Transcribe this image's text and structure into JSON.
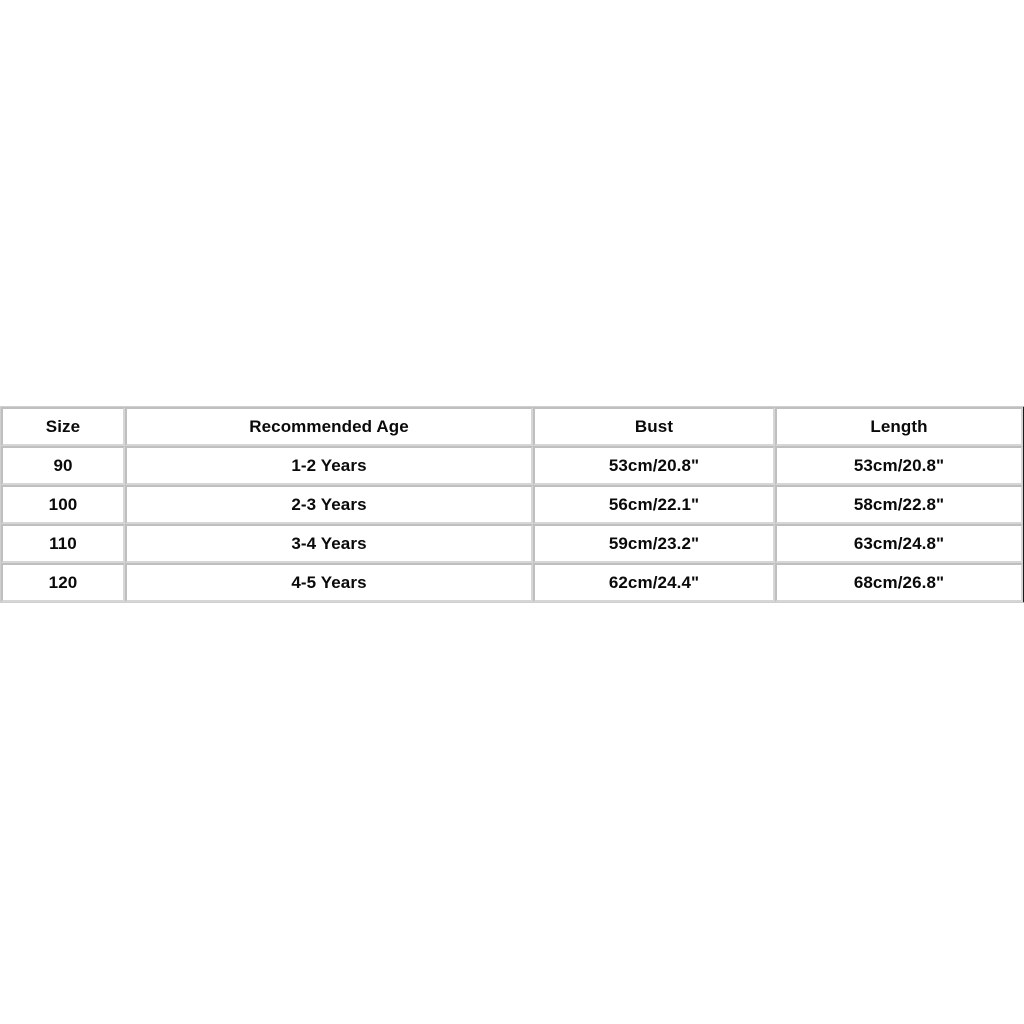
{
  "page": {
    "background_color": "#ffffff",
    "accent_color": "#1b1b1b"
  },
  "size_chart": {
    "name": "size-chart-table",
    "border_color": "#d6d6d6",
    "outer_border_color": "#1b1b1b",
    "text_color": "#0a0a0a",
    "columns": [
      {
        "key": "size",
        "label": "Size"
      },
      {
        "key": "age",
        "label": "Recommended Age"
      },
      {
        "key": "bust",
        "label": "Bust"
      },
      {
        "key": "length",
        "label": "Length"
      }
    ],
    "rows": [
      {
        "size": "90",
        "age": "1-2 Years",
        "bust": "53cm/20.8\"",
        "length": "53cm/20.8\""
      },
      {
        "size": "100",
        "age": "2-3 Years",
        "bust": "56cm/22.1\"",
        "length": "58cm/22.8\""
      },
      {
        "size": "110",
        "age": "3-4 Years",
        "bust": "59cm/23.2\"",
        "length": "63cm/24.8\""
      },
      {
        "size": "120",
        "age": "4-5 Years",
        "bust": "62cm/24.4\"",
        "length": "68cm/26.8\""
      }
    ]
  }
}
